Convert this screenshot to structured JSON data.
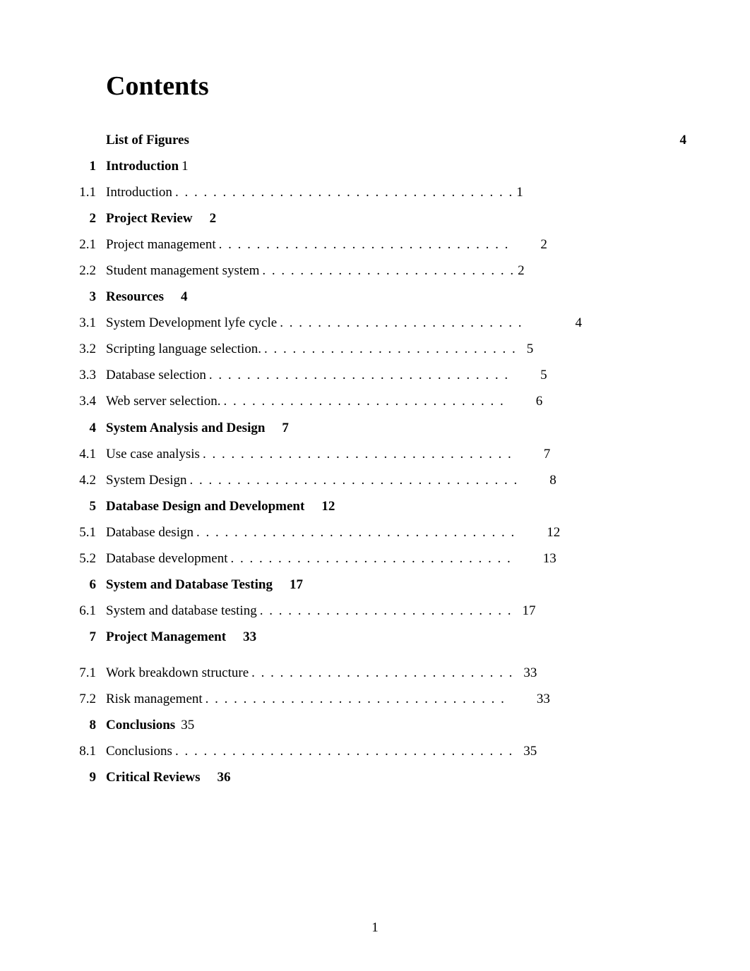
{
  "title": "Contents",
  "page_number": "1",
  "list_of_figures": {
    "label": "List of Figures",
    "page": "4"
  },
  "entries": [
    {
      "type": "chapter",
      "num": "1",
      "label": "Introduction",
      "page": "1",
      "inline_tight": true
    },
    {
      "type": "section",
      "num": "1.1",
      "label": "Introduction",
      "dots": ". . . . . . . . . . . . . . . . . . . . . . . . . . . . . . . . . . . .",
      "page": "1",
      "page_class": "tight"
    },
    {
      "type": "chapter",
      "num": "2",
      "label": "Project Review",
      "page": "2"
    },
    {
      "type": "section",
      "num": "2.1",
      "label": "Project management",
      "dots": ". . . . . . . . . . . . . . . . . . . . . . . . . . . . . . .",
      "page": "2",
      "page_class": "far"
    },
    {
      "type": "section",
      "num": "2.2",
      "label": "Student management system",
      "dots": ". . . . . . . . . . . . . . . . . . . . . . . . . . .",
      "page": "2",
      "page_class": "tight"
    },
    {
      "type": "chapter",
      "num": "3",
      "label": "Resources",
      "page": "4"
    },
    {
      "type": "section",
      "num": "3.1",
      "label": "System Development lyfe cycle",
      "dots": ". . . . . . . . . . . . . . . . . . . . . . . . . .",
      "page": "4",
      "page_class": "farfar"
    },
    {
      "type": "section",
      "num": "3.2",
      "label": "Scripting language selection.",
      "dots": ". . . . . . . . . . . . . . . . . . . . . . . . . . .",
      "page": "5",
      "page_class": "after"
    },
    {
      "type": "section",
      "num": "3.3",
      "label": "Database selection  ",
      "dots": ". . . . . . . . . . . . . . . . . . . . . . . . . . . . . . . .",
      "page": "5",
      "page_class": "far"
    },
    {
      "type": "section",
      "num": "3.4",
      "label": "Web server selection.",
      "dots": ". . . . . . . . . . . . . . . . . . . . . . . . . . . . . .",
      "page": "6",
      "page_class": "far"
    },
    {
      "type": "chapter",
      "num": "4",
      "label": "System Analysis and Design",
      "page": "7"
    },
    {
      "type": "section",
      "num": "4.1",
      "label": "Use case analysis",
      "dots": ". . . . . . . . . . . . . . . . . . . . . . . . . . . . . . . . .",
      "page": "7",
      "page_class": "far"
    },
    {
      "type": "section",
      "num": "4.2",
      "label": "System Design",
      "dots": ". . . . . . . . . . . . . . . . . . . . . . . . . . . . . . . . . . .",
      "page": "8",
      "page_class": "far"
    },
    {
      "type": "chapter",
      "num": "5",
      "label": "Database Design and Development",
      "page": "12"
    },
    {
      "type": "section",
      "num": "5.1",
      "label": "Database design",
      "dots": ". . . . . . . . . . . . . . . . . . . . . . . . . . . . . . . . . .",
      "page": "12",
      "page_class": "far"
    },
    {
      "type": "section",
      "num": "5.2",
      "label": "Database development",
      "dots": ". . . . . . . . . . . . . . . . . . . . . . . . . . . . . .",
      "page": "13",
      "page_class": "far"
    },
    {
      "type": "chapter",
      "num": "6",
      "label": "System and Database Testing",
      "page": "17"
    },
    {
      "type": "section",
      "num": "6.1",
      "label": "System and database testing",
      "dots": ". . . . . . . . . . . . . . . . . . . . . . . . . . .",
      "page": "17",
      "page_class": "after"
    },
    {
      "type": "chapter",
      "num": "7",
      "label": "Project Management",
      "page": "33"
    },
    {
      "type": "gap"
    },
    {
      "type": "section",
      "num": "7.1",
      "label": "Work breakdown structure",
      "dots": ". . . . . . . . . . . . . . . . . . . . . . . . . . . .",
      "page": "33",
      "page_class": "after"
    },
    {
      "type": "section",
      "num": "7.2",
      "label": "Risk management",
      "dots": ". . . . . . . . . . . . . . . . . . . . . . . . . . . . . . . .",
      "page": "33",
      "page_class": "far"
    },
    {
      "type": "chapter",
      "num": "8",
      "label": "Conclusions",
      "page": "35",
      "inline_tight": false,
      "inline_mid": true
    },
    {
      "type": "section",
      "num": "8.1",
      "label": "Conclusions",
      "dots": ". . . . . . . . . . . . . . . . . . . . . . . . . . . . . . . . . . . .",
      "page": "35",
      "page_class": "after"
    },
    {
      "type": "chapter",
      "num": "9",
      "label": "Critical Reviews",
      "page": "36"
    }
  ]
}
